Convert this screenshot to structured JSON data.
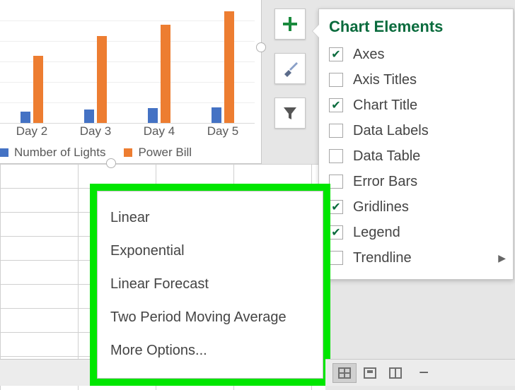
{
  "chart_data": {
    "type": "bar",
    "categories": [
      "Day 2",
      "Day 3",
      "Day 4",
      "Day 5"
    ],
    "series": [
      {
        "name": "Number of Lights",
        "color": "#4472c4",
        "values": [
          10,
          12,
          13,
          14
        ]
      },
      {
        "name": "Power Bill",
        "color": "#ed7d31",
        "values": [
          60,
          78,
          88,
          100
        ]
      }
    ],
    "ylim": [
      0,
      110
    ],
    "gridlines": true
  },
  "side_buttons": {
    "add": "plus-icon",
    "styles": "brush-icon",
    "filter": "funnel-icon"
  },
  "flyout": {
    "title": "Chart Elements",
    "options": [
      {
        "label": "Axes",
        "checked": true,
        "has_sub": false
      },
      {
        "label": "Axis Titles",
        "checked": false,
        "has_sub": false
      },
      {
        "label": "Chart Title",
        "checked": true,
        "has_sub": false
      },
      {
        "label": "Data Labels",
        "checked": false,
        "has_sub": false
      },
      {
        "label": "Data Table",
        "checked": false,
        "has_sub": false
      },
      {
        "label": "Error Bars",
        "checked": false,
        "has_sub": false
      },
      {
        "label": "Gridlines",
        "checked": true,
        "has_sub": false
      },
      {
        "label": "Legend",
        "checked": true,
        "has_sub": false
      },
      {
        "label": "Trendline",
        "checked": false,
        "has_sub": true
      }
    ]
  },
  "trendline_submenu": [
    "Linear",
    "Exponential",
    "Linear Forecast",
    "Two Period Moving Average",
    "More Options..."
  ],
  "status_bar": {
    "views": [
      "normal-view",
      "page-layout-view",
      "page-break-view"
    ],
    "active_view_index": 0,
    "zoom_minus": "−"
  }
}
